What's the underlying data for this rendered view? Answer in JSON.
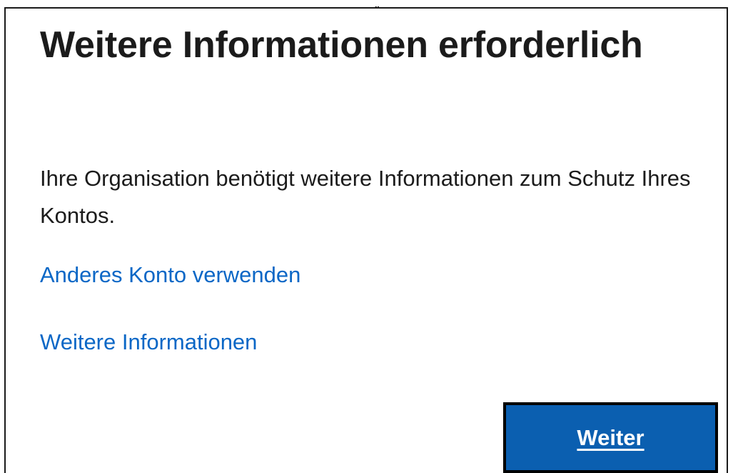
{
  "header": {
    "quote_mark": "„"
  },
  "dialog": {
    "title": "Weitere Informationen erforderlich",
    "description": "Ihre Organisation benötigt weitere Informationen zum Schutz Ihres Kontos.",
    "links": {
      "use_other_account": "Anderes Konto verwenden",
      "more_information": "Weitere Informationen"
    },
    "next_button_label": "Weiter"
  },
  "colors": {
    "link": "#0a67c6",
    "button_background": "#0b5fb0",
    "button_border": "#000000",
    "text": "#1b1b1b",
    "frame_border": "#1a1a1a"
  }
}
